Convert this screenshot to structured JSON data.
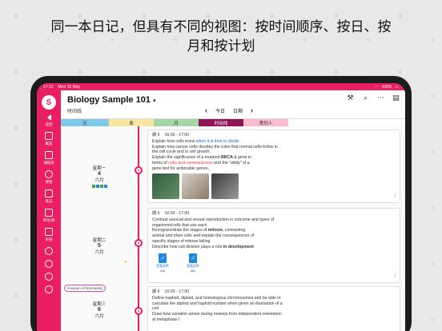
{
  "headline": "同一本日记，但具有不同的视图：按时间顺序、按日、按月和按计划",
  "status": {
    "time": "17:12",
    "date": "Mon 15 May",
    "battery": "100%"
  },
  "sidebar": {
    "logo": "S",
    "items": [
      {
        "label": "返回",
        "icon": "back-icon"
      },
      {
        "label": "概览",
        "icon": "overview-icon"
      },
      {
        "label": "课程表",
        "icon": "timetable-icon"
      },
      {
        "label": "课程",
        "icon": "lessons-icon"
      },
      {
        "label": "笔记",
        "icon": "notes-icon"
      },
      {
        "label": "单位/课",
        "icon": "units-icon"
      },
      {
        "label": "外链",
        "icon": "pin-icon"
      },
      {
        "label": "",
        "icon": "plus-icon"
      },
      {
        "label": "",
        "icon": "check-icon"
      },
      {
        "label": "",
        "icon": "help-icon"
      },
      {
        "label": "",
        "icon": "settings-icon"
      }
    ]
  },
  "header": {
    "title": "Biology Sample 101",
    "title_caret": "▾",
    "subtitle": "时间线",
    "nav_prev": "‹",
    "nav_today": "今日",
    "nav_day": "日期",
    "nav_next": "›"
  },
  "tabs": [
    {
      "label": "天",
      "color": "#7ec8e8"
    },
    {
      "label": "周",
      "color": "#f9e79f"
    },
    {
      "label": "月",
      "color": "#a5d6a7"
    },
    {
      "label": "时间线",
      "color": "#8e1457"
    },
    {
      "label": "策划人",
      "color": "#f8bbd0"
    }
  ],
  "days": [
    {
      "weekday": "星期一",
      "num": "4",
      "month": "六月"
    },
    {
      "weekday": "星期二",
      "num": "5",
      "month": "六月"
    },
    {
      "weekday": "星期三",
      "num": "6",
      "month": "六月"
    }
  ],
  "tag_label": "Invasion of Normandy",
  "cards": [
    {
      "period": "期 6",
      "time": "16:00 - 17:00",
      "l1a": "Explain how cells know ",
      "l1b": "when it is time to divide.",
      "l2": "Explain how cancer cells disobey the rules that normal cells follow in",
      "l3": "the cell cycle and in cell growth.",
      "l4a": "Explain the significance of a mutated ",
      "l4b": "BRCA-1",
      "l4c": " gene in",
      "l5a": "terms of ",
      "l5b": "risks and consequences",
      "l5c": " and the \"utility\" of a",
      "l6": "gene test for actionable genes."
    },
    {
      "period": "期 6",
      "time": "16:00 - 17:00",
      "l1": "Contrast asexual and sexual reproduction in outcome and types of",
      "l2": "organisms/cells that use each",
      "l3a": "Recognize/draw the stages of ",
      "l3b": "mitosis",
      "l3c": ", contrasting",
      "l4": "animal and plant cells and explain the consequences of",
      "l5": "specific stages of mitosis failing.",
      "l6a": "Describe how cell division plays a role ",
      "l6b": "in development",
      "files": [
        {
          "name": "音频文件",
          "size": "44s"
        },
        {
          "name": "音频文件",
          "size": "38s"
        }
      ]
    },
    {
      "period": "期 6",
      "time": "16:00 - 17:00",
      "l1": "Define haploid, diploid, and homologous chromosomes and be able to",
      "l2": "calculate the diploid and haploid number when given an illustration of a",
      "l3": "cell",
      "l4": "Draw how variation arises during meiosis from independent orientation",
      "l5": "at metaphase I."
    }
  ]
}
